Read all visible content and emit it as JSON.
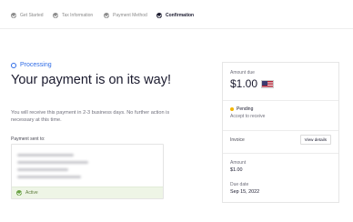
{
  "stepper": {
    "steps": [
      {
        "label": "Get Started",
        "state": "done"
      },
      {
        "label": "Tax Information",
        "state": "done"
      },
      {
        "label": "Payment Method",
        "state": "done"
      },
      {
        "label": "Confirmation",
        "state": "active"
      }
    ]
  },
  "status": {
    "label": "Processing",
    "color": "#2e6be6"
  },
  "main": {
    "headline": "Your payment is on its way!",
    "subtext": "You will receive this payment in 2-3 business days. No further action is necessary at this time.",
    "sent_to_label": "Payment sent to:",
    "recipient_status": "Active"
  },
  "summary": {
    "amount_due_label": "Amount due",
    "amount_due_value": "$1.00",
    "currency_flag": "us-flag-icon",
    "status_label": "Pending",
    "status_sub": "Accept to receive",
    "invoice_label": "Invoice",
    "view_details_label": "View details",
    "amount_label": "Amount",
    "amount_value": "$1.00",
    "due_date_label": "Due date",
    "due_date_value": "Sep 15, 2022"
  },
  "colors": {
    "accent": "#2e6be6",
    "pending": "#f2b400",
    "active_green": "#6aa343"
  }
}
